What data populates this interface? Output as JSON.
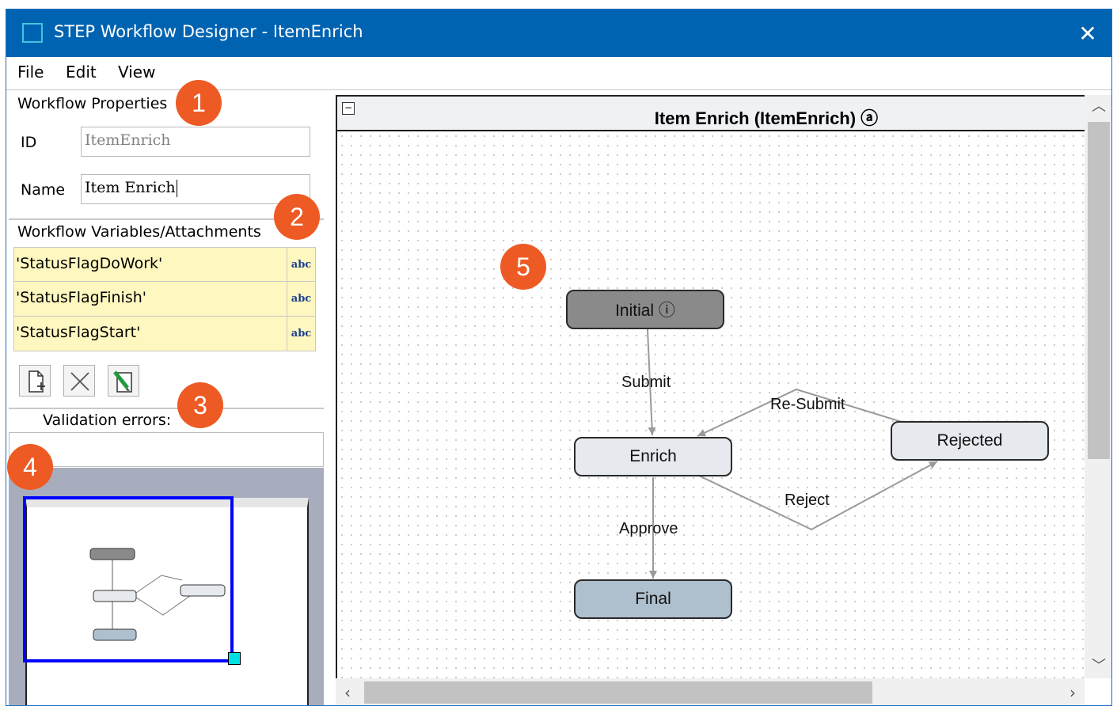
{
  "window": {
    "title": "STEP Workflow Designer - ItemEnrich",
    "close_glyph": "✕"
  },
  "menu": {
    "items": [
      "File",
      "Edit",
      "View"
    ]
  },
  "workflow_properties": {
    "heading": "Workflow Properties",
    "id_label": "ID",
    "id_value": "ItemEnrich",
    "name_label": "Name",
    "name_value": "Item Enrich"
  },
  "variables": {
    "heading": "Workflow Variables/Attachments",
    "rows": [
      {
        "name": "'StatusFlagDoWork'",
        "type": "abc"
      },
      {
        "name": "'StatusFlagFinish'",
        "type": "abc"
      },
      {
        "name": "'StatusFlagStart'",
        "type": "abc"
      }
    ],
    "tool_icons": [
      "new-variable-icon",
      "delete-variable-icon",
      "edit-variable-icon"
    ]
  },
  "validation": {
    "label": "Validation errors:"
  },
  "canvas": {
    "title": "Item Enrich (ItemEnrich) ⓐ",
    "collapse_glyph": "−",
    "states": {
      "initial": "Initial ⓘ",
      "enrich": "Enrich",
      "rejected": "Rejected",
      "final": "Final"
    },
    "transitions": {
      "submit": "Submit",
      "resubmit": "Re-Submit",
      "reject": "Reject",
      "approve": "Approve"
    },
    "colors": {
      "initial": "#8a8a8a",
      "normal": "#e6eaee",
      "final": "#aebfce",
      "edge": "#9a9a9a"
    }
  },
  "scrollbar": {
    "up": "︿",
    "down": "﹀",
    "left": "‹",
    "right": "›"
  },
  "callouts": [
    "1",
    "2",
    "3",
    "4",
    "5"
  ],
  "callout_color": "#ee5a24"
}
